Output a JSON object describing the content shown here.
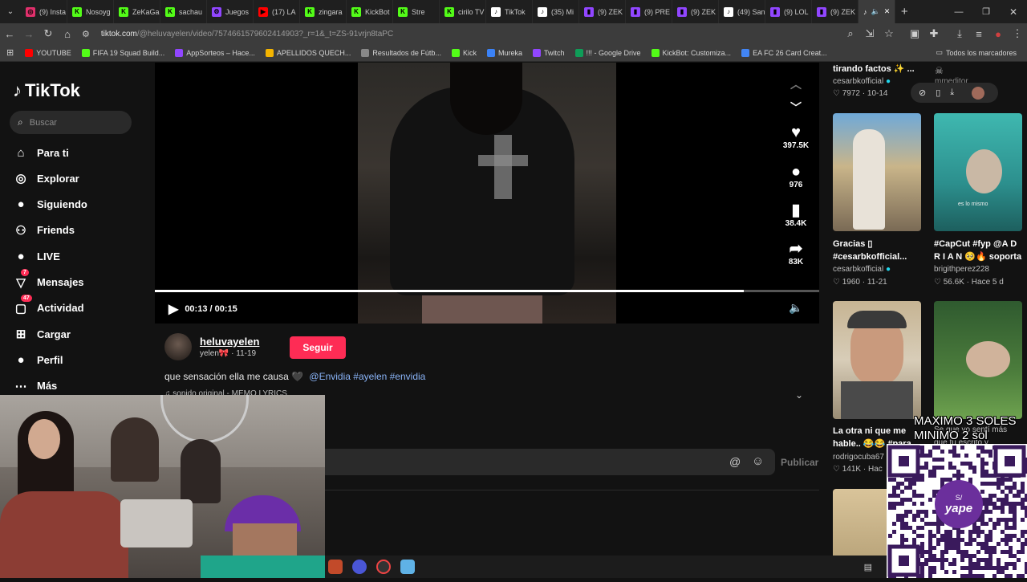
{
  "browser": {
    "tabs": [
      {
        "label": "(9) Insta",
        "fav_color": "#e1306c",
        "fav_glyph": "◎"
      },
      {
        "label": "Nosoyg",
        "fav_color": "#53fc18",
        "fav_glyph": "K"
      },
      {
        "label": "ZeKaGa",
        "fav_color": "#53fc18",
        "fav_glyph": "K"
      },
      {
        "label": "sachau",
        "fav_color": "#53fc18",
        "fav_glyph": "K"
      },
      {
        "label": "Juegos",
        "fav_color": "#9146ff",
        "fav_glyph": "⚙"
      },
      {
        "label": "(17) LA",
        "fav_color": "#ff0000",
        "fav_glyph": "▶"
      },
      {
        "label": "zingara",
        "fav_color": "#53fc18",
        "fav_glyph": "K"
      },
      {
        "label": "KickBot",
        "fav_color": "#53fc18",
        "fav_glyph": "K"
      },
      {
        "label": "Stre",
        "fav_color": "#53fc18",
        "fav_glyph": "K"
      },
      {
        "label": "cirilo TV",
        "fav_color": "#53fc18",
        "fav_glyph": "K"
      },
      {
        "label": "TikTok",
        "fav_color": "#ffffff",
        "fav_glyph": "♪"
      },
      {
        "label": "(35) Mi",
        "fav_color": "#ffffff",
        "fav_glyph": "♪"
      },
      {
        "label": "(9) ZEK",
        "fav_color": "#9146ff",
        "fav_glyph": "▮"
      },
      {
        "label": "(9) PRE",
        "fav_color": "#9146ff",
        "fav_glyph": "▮"
      },
      {
        "label": "(9) ZEK",
        "fav_color": "#9146ff",
        "fav_glyph": "▮"
      },
      {
        "label": "(49) San",
        "fav_color": "#ffffff",
        "fav_glyph": "♪"
      },
      {
        "label": "(9) LOL",
        "fav_color": "#9146ff",
        "fav_glyph": "▮"
      },
      {
        "label": "(9) ZEK",
        "fav_color": "#9146ff",
        "fav_glyph": "▮"
      }
    ],
    "url_host": "tiktok.com",
    "url_path": "/@heluvayelen/video/7574661579602414903?_r=1&_t=ZS-91vrjn8taPC",
    "bookmarks": [
      {
        "label": "YOUTUBE",
        "color": "#ff0000"
      },
      {
        "label": "FIFA 19 Squad Build...",
        "color": "#53fc18"
      },
      {
        "label": "AppSorteos – Hace...",
        "color": "#9146ff"
      },
      {
        "label": "APELLIDOS QUECH...",
        "color": "#f4b400"
      },
      {
        "label": "Resultados de Fútb...",
        "color": "#888888"
      },
      {
        "label": "Kick",
        "color": "#53fc18"
      },
      {
        "label": "Mureka",
        "color": "#3b82f6"
      },
      {
        "label": "Twitch",
        "color": "#9146ff"
      },
      {
        "label": "!!! - Google Drive",
        "color": "#0f9d58"
      },
      {
        "label": "KickBot: Customiza...",
        "color": "#53fc18"
      },
      {
        "label": "EA FC 26 Card Creat...",
        "color": "#4285f4"
      }
    ],
    "all_bookmarks": "Todos los marcadores"
  },
  "tiktok": {
    "logo": "TikTok",
    "search_placeholder": "Buscar",
    "nav": [
      {
        "label": "Para ti",
        "icon": "home-icon",
        "glyph": "⌂"
      },
      {
        "label": "Explorar",
        "icon": "compass-icon",
        "glyph": "◎"
      },
      {
        "label": "Siguiendo",
        "icon": "following-icon",
        "glyph": "●"
      },
      {
        "label": "Friends",
        "icon": "friends-icon",
        "glyph": "⚇"
      },
      {
        "label": "LIVE",
        "icon": "live-icon",
        "glyph": "●"
      },
      {
        "label": "Mensajes",
        "icon": "messages-icon",
        "glyph": "▽",
        "badge": "7"
      },
      {
        "label": "Actividad",
        "icon": "activity-icon",
        "glyph": "▢",
        "badge": "47"
      },
      {
        "label": "Cargar",
        "icon": "upload-icon",
        "glyph": "⊞"
      },
      {
        "label": "Perfil",
        "icon": "profile-icon",
        "glyph": "●"
      },
      {
        "label": "Más",
        "icon": "more-icon",
        "glyph": "⋯"
      }
    ]
  },
  "video": {
    "time": "00:13 / 00:15",
    "progress": 0.887,
    "likes": "397.5K",
    "comments": "976",
    "saves": "38.4K",
    "shares": "83K"
  },
  "post": {
    "username": "heluvayelen",
    "display_name": "yelen🎀",
    "date": "· 11-19",
    "follow_label": "Seguir",
    "caption": "que sensación ella me causa 🖤",
    "tags": "@Envidia #ayelen #envidia",
    "sound": "♫ sonido original - MEMO LYRICS",
    "publish_label": "Publicar"
  },
  "recommended": {
    "top": [
      {
        "title": "tirando factos ✨ ...",
        "author": "cesarbkofficial",
        "likes": "7972",
        "date": "10-14",
        "verified": true
      },
      {
        "title": "",
        "author": "mmeditor_",
        "likes": "",
        "date": "10-??",
        "verified": false
      }
    ],
    "row1": [
      {
        "title": "Gracias ▯",
        "title2": "#cesarbkofficial...",
        "author": "cesarbkofficial",
        "likes": "1960",
        "date": "11-21",
        "verified": true
      },
      {
        "title": "#CapCut #fyp @A D",
        "title2": "R I A N 🥺🔥 soporta",
        "author": "brigithperez228",
        "likes": "56.6K",
        "date": "Hace 5 d",
        "verified": false
      }
    ],
    "row2": [
      {
        "title": "La otra ni que me",
        "title2": "hable.. 😂😂 #para",
        "author": "rodrigocuba67",
        "likes": "141K",
        "date": "Hac",
        "verified": false
      },
      {
        "title": "Se que yo sentí más",
        "title2": "que tu escrito y",
        "author": "",
        "likes": "",
        "date": "",
        "verified": false
      }
    ],
    "thumb2_caption": "es lo mismo"
  },
  "overlay": {
    "line1": "MAXIMO 3 SOLES",
    "line2": "MINIMO 2 sol",
    "brand": "yape",
    "currency": "S/"
  }
}
